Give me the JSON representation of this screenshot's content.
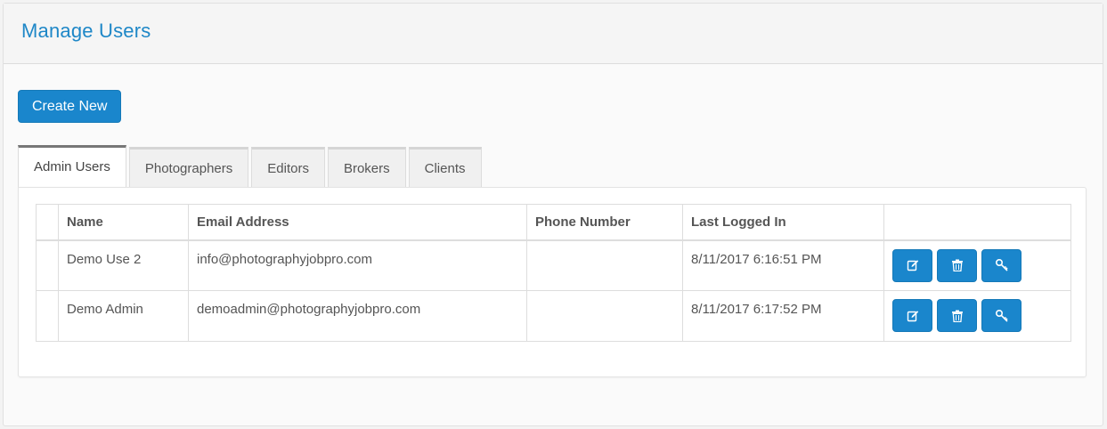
{
  "header": {
    "title": "Manage Users"
  },
  "toolbar": {
    "create_label": "Create New"
  },
  "tabs": [
    {
      "label": "Admin Users",
      "active": true
    },
    {
      "label": "Photographers",
      "active": false
    },
    {
      "label": "Editors",
      "active": false
    },
    {
      "label": "Brokers",
      "active": false
    },
    {
      "label": "Clients",
      "active": false
    }
  ],
  "table": {
    "columns": [
      "",
      "Name",
      "Email Address",
      "Phone Number",
      "Last Logged In",
      ""
    ],
    "rows": [
      {
        "name": "Demo Use 2",
        "email": "info@photographyjobpro.com",
        "phone": "",
        "last_login": "8/11/2017 6:16:51 PM"
      },
      {
        "name": "Demo Admin",
        "email": "demoadmin@photographyjobpro.com",
        "phone": "",
        "last_login": "8/11/2017 6:17:52 PM"
      }
    ],
    "row_actions": [
      "edit-icon",
      "trash-icon",
      "key-icon"
    ]
  },
  "colors": {
    "accent": "#1a86cc",
    "title": "#1e87c7"
  }
}
